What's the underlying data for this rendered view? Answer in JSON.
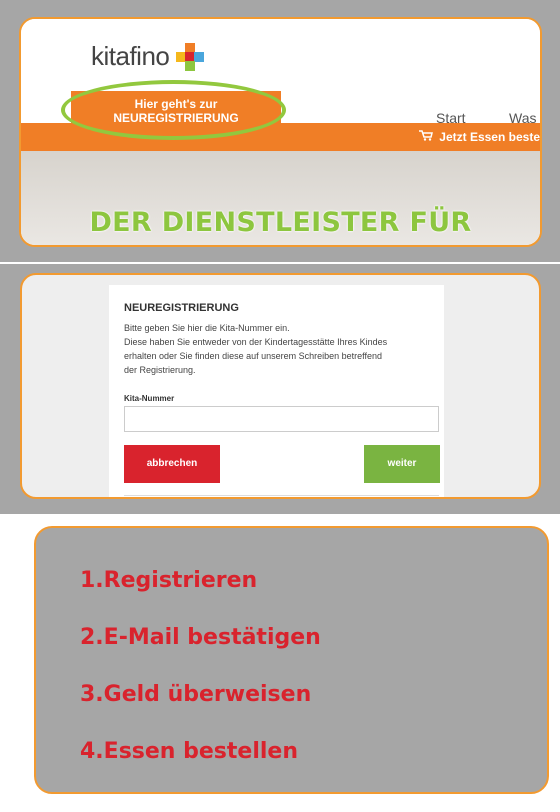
{
  "brand": {
    "logo_text": "kitafino",
    "colors": {
      "orange": "#f07e26",
      "green": "#8dc63f",
      "red": "#d9232d",
      "frame_gray": "#a6a6a6",
      "border_orange": "#f29a30"
    }
  },
  "header": {
    "register_button_line1": "Hier geht's zur",
    "register_button_line2": "NEUREGISTRIERUNG",
    "nav": [
      "Start",
      "Was"
    ],
    "order_banner": "Jetzt Essen beste",
    "hero_text": "DER DIENSTLEISTER FÜR"
  },
  "form": {
    "title": "NEUREGISTRIERUNG",
    "description_lines": [
      "Bitte geben Sie hier die Kita-Nummer ein.",
      "Diese haben Sie entweder von der Kindertagesstätte Ihres Kindes",
      "erhalten oder Sie finden diese auf unserem Schreiben betreffend",
      "der Registrierung."
    ],
    "field_label": "Kita-Nummer",
    "field_value": "",
    "cancel_label": "abbrechen",
    "next_label": "weiter"
  },
  "steps": [
    "1.Registrieren",
    "2.E-Mail bestätigen",
    "3.Geld überweisen",
    "4.Essen bestellen"
  ]
}
